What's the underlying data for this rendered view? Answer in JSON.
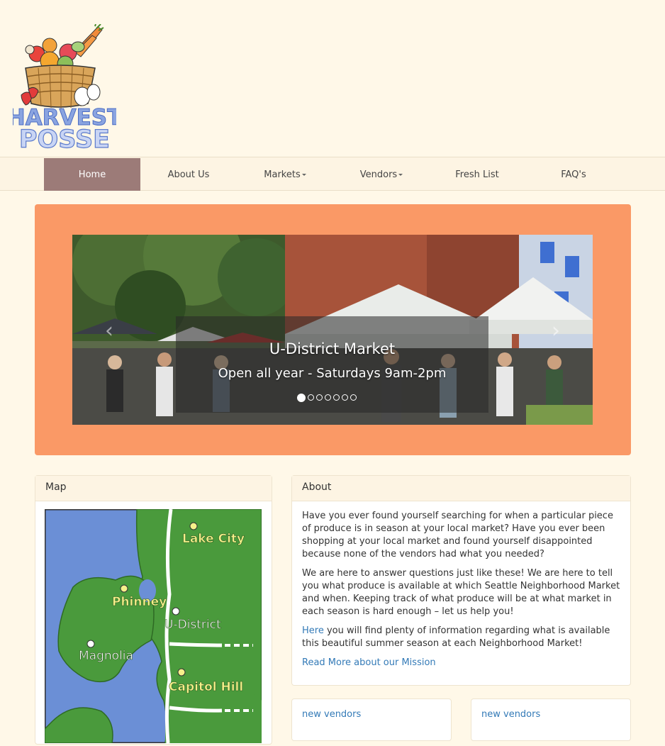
{
  "brand": {
    "logo_line1": "HARVEST",
    "logo_line2": "POSSE",
    "accent": "#fa9966",
    "nav_active_bg": "#9c7b78",
    "link_color": "#337ab7"
  },
  "nav": {
    "items": [
      {
        "label": "Home",
        "active": true
      },
      {
        "label": "About Us"
      },
      {
        "label": "Markets",
        "dropdown": true
      },
      {
        "label": "Vendors",
        "dropdown": true
      },
      {
        "label": "Fresh List"
      },
      {
        "label": "FAQ's"
      }
    ]
  },
  "carousel": {
    "title": "U-District Market",
    "subtitle": "Open all year - Saturdays 9am-2pm",
    "slide_count": 7,
    "active_index": 0,
    "prev_icon": "chevron-left-icon",
    "next_icon": "chevron-right-icon"
  },
  "map_panel": {
    "heading": "Map",
    "labels": {
      "lake_city": "Lake City",
      "phinney": "Phinney",
      "u_district": "U-District",
      "magnolia": "Magnolia",
      "capitol_hill": "Capitol Hill"
    }
  },
  "about_panel": {
    "heading": "About",
    "p1": "Have you ever found yourself searching for when a particular piece of produce is in season at your local market? Have you ever been shopping at your local market and found yourself disappointed because none of the vendors had what you needed?",
    "p2": "We are here to answer questions just like these! We are here to tell you what produce is available at which Seattle Neighborhood Market and when. Keeping track of what produce will be at what market in each season is hard enough – let us help you!",
    "p3_link": "Here",
    "p3_rest": " you will find plenty of information regarding what is available this beautiful summer season at each Neighborhood Market!",
    "read_more": "Read More about our Mission"
  },
  "vendor_cards": [
    {
      "label": "new vendors"
    },
    {
      "label": "new vendors"
    }
  ]
}
